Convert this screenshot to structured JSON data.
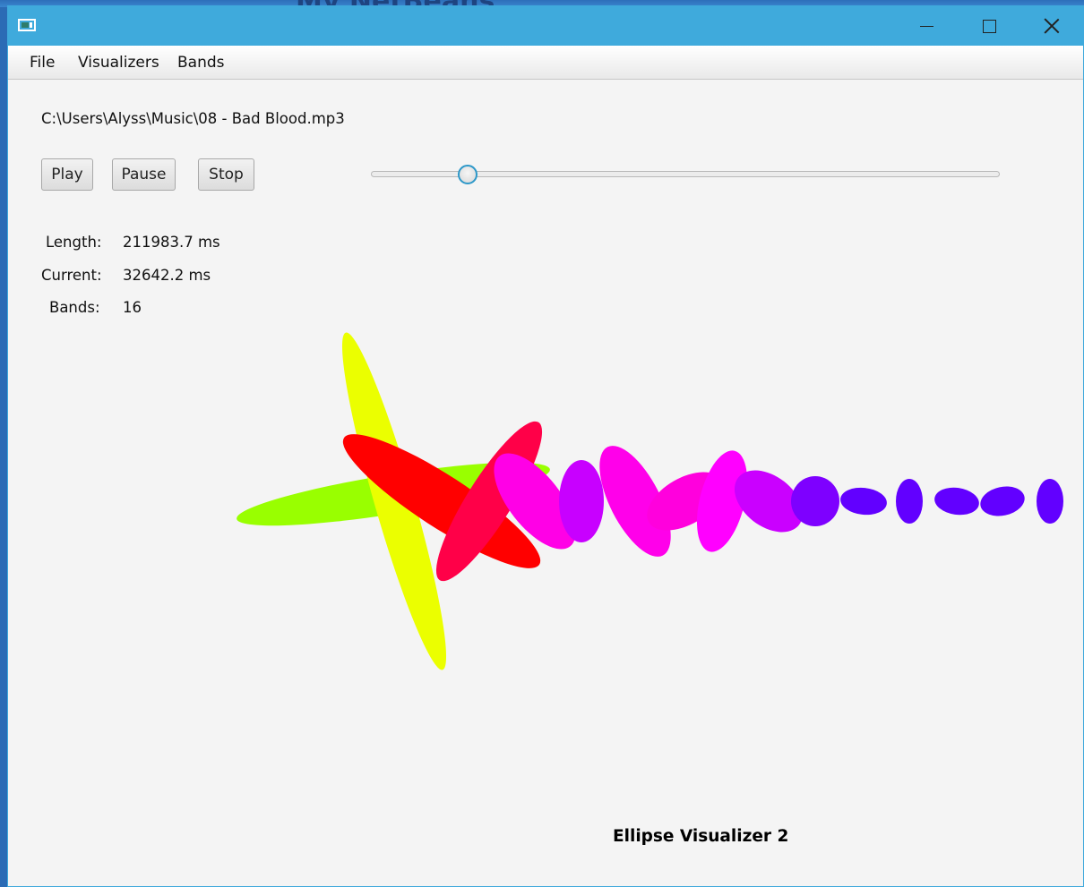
{
  "desktop": {
    "background_text": "My NetBeans"
  },
  "window": {
    "controls": {
      "minimize": "minimize-icon",
      "maximize": "maximize-icon",
      "close": "close-icon"
    }
  },
  "menu": {
    "items": [
      "File",
      "Visualizers",
      "Bands"
    ]
  },
  "player": {
    "file_path": "C:\\Users\\Alyss\\Music\\08 - Bad Blood.mp3",
    "buttons": {
      "play": "Play",
      "pause": "Pause",
      "stop": "Stop"
    },
    "progress_fraction": 0.154
  },
  "info": {
    "length_label": "Length:",
    "length_value": "211983.7 ms",
    "current_label": "Current:",
    "current_value": "32642.2 ms",
    "bands_label": "Bands:",
    "bands_value": "16"
  },
  "visualizer": {
    "title": "Ellipse Visualizer 2",
    "ellipse_colors": [
      "#99ff00",
      "#ebff00",
      "#ff0000",
      "#ff0048",
      "#ff00e6",
      "#c800ff",
      "#ff00ea",
      "#ff00dd",
      "#ff00ff",
      "#ca00ff",
      "#7e00ff",
      "#6200ff",
      "#6200ff",
      "#6200ff",
      "#6200ff",
      "#6200ff"
    ]
  }
}
